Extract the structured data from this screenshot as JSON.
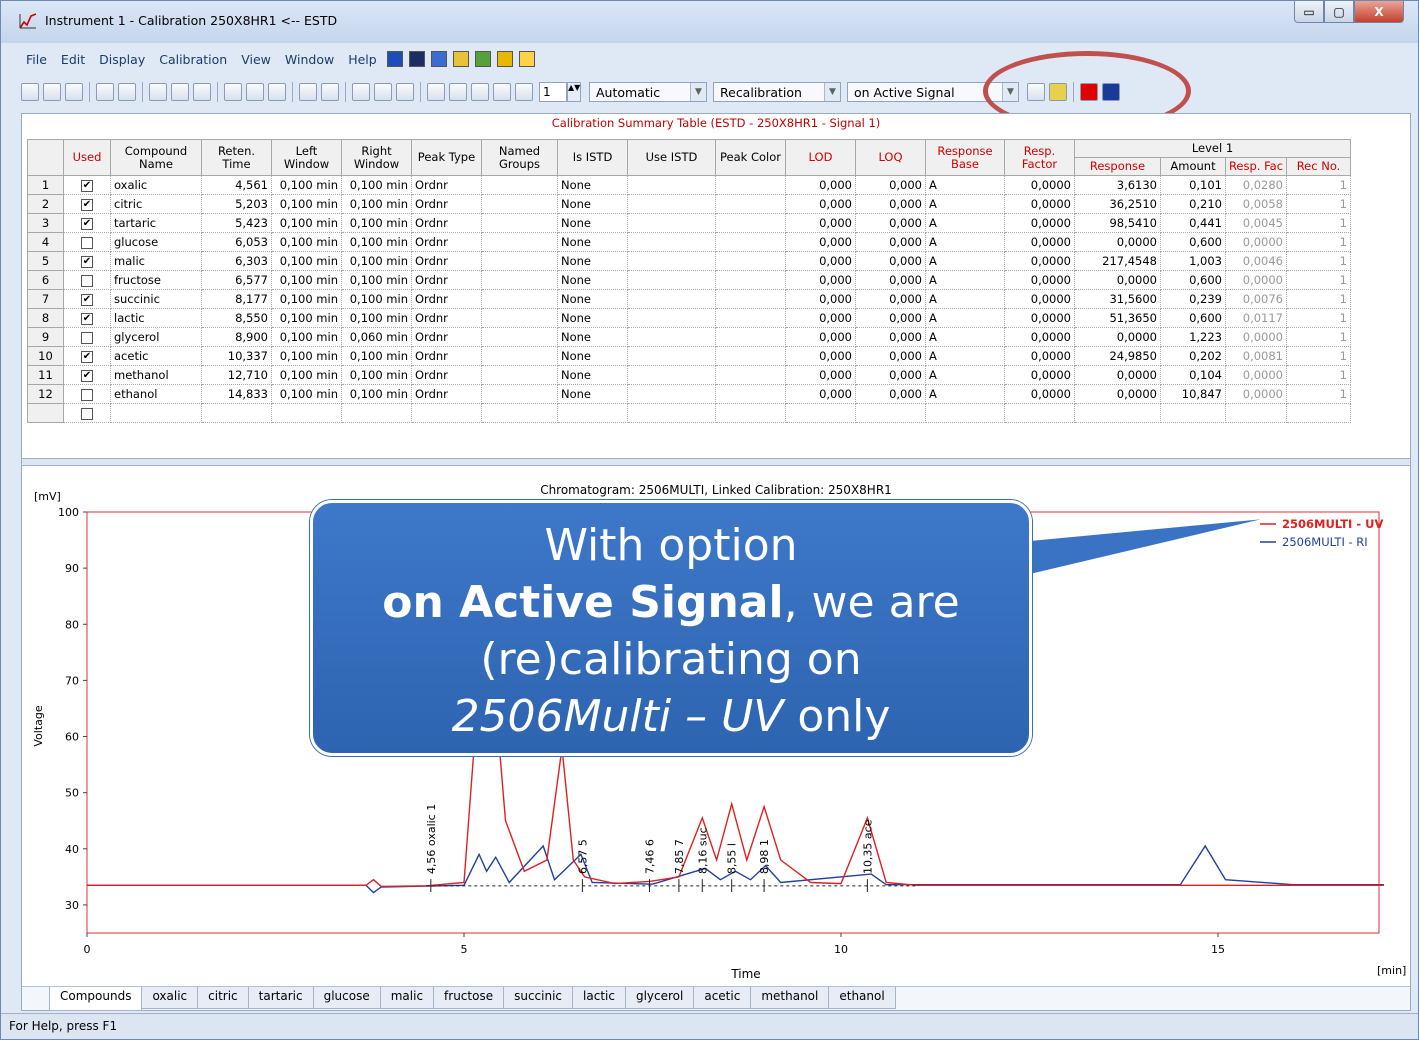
{
  "window": {
    "title": "Instrument 1 - Calibration 250X8HR1 <-- ESTD",
    "min": "▭",
    "max": "▢",
    "close": "X"
  },
  "menu": [
    "File",
    "Edit",
    "Display",
    "Calibration",
    "View",
    "Window",
    "Help"
  ],
  "toolbar": {
    "spin_value": "1",
    "mode": "Automatic",
    "cal_action": "Recalibration",
    "signal_option": "on Active Signal"
  },
  "table": {
    "title": "Calibration Summary Table (ESTD - 250X8HR1 - Signal 1)",
    "headers": {
      "used": "Used",
      "name": "Compound Name",
      "ret": "Reten. Time",
      "left": "Left Window",
      "right": "Right Window",
      "ptype": "Peak Type",
      "named": "Named Groups",
      "istd": "Is ISTD",
      "useistd": "Use ISTD",
      "color": "Peak Color",
      "lod": "LOD",
      "loq": "LOQ",
      "rbase": "Response Base",
      "rfactor": "Resp. Factor",
      "level": "Level 1",
      "response": "Response",
      "amount": "Amount",
      "respfac": "Resp. Fac",
      "recno": "Rec No."
    },
    "rows": [
      {
        "n": "1",
        "used": true,
        "name": "oxalic",
        "ret": "4,561",
        "left": "0,100 min",
        "right": "0,100 min",
        "ptype": "Ordnr",
        "istd": "None",
        "lod": "0,000",
        "loq": "0,000",
        "rbase": "A",
        "rfactor": "0,0000",
        "response": "3,6130",
        "amount": "0,101",
        "respfac": "0,0280",
        "recno": "1"
      },
      {
        "n": "2",
        "used": true,
        "name": "citric",
        "ret": "5,203",
        "left": "0,100 min",
        "right": "0,100 min",
        "ptype": "Ordnr",
        "istd": "None",
        "lod": "0,000",
        "loq": "0,000",
        "rbase": "A",
        "rfactor": "0,0000",
        "response": "36,2510",
        "amount": "0,210",
        "respfac": "0,0058",
        "recno": "1"
      },
      {
        "n": "3",
        "used": true,
        "name": "tartaric",
        "ret": "5,423",
        "left": "0,100 min",
        "right": "0,100 min",
        "ptype": "Ordnr",
        "istd": "None",
        "lod": "0,000",
        "loq": "0,000",
        "rbase": "A",
        "rfactor": "0,0000",
        "response": "98,5410",
        "amount": "0,441",
        "respfac": "0,0045",
        "recno": "1"
      },
      {
        "n": "4",
        "used": false,
        "name": "glucose",
        "ret": "6,053",
        "left": "0,100 min",
        "right": "0,100 min",
        "ptype": "Ordnr",
        "istd": "None",
        "lod": "0,000",
        "loq": "0,000",
        "rbase": "A",
        "rfactor": "0,0000",
        "response": "0,0000",
        "amount": "0,600",
        "respfac": "0,0000",
        "recno": "1"
      },
      {
        "n": "5",
        "used": true,
        "name": "malic",
        "ret": "6,303",
        "left": "0,100 min",
        "right": "0,100 min",
        "ptype": "Ordnr",
        "istd": "None",
        "lod": "0,000",
        "loq": "0,000",
        "rbase": "A",
        "rfactor": "0,0000",
        "response": "217,4548",
        "amount": "1,003",
        "respfac": "0,0046",
        "recno": "1"
      },
      {
        "n": "6",
        "used": false,
        "name": "fructose",
        "ret": "6,577",
        "left": "0,100 min",
        "right": "0,100 min",
        "ptype": "Ordnr",
        "istd": "None",
        "lod": "0,000",
        "loq": "0,000",
        "rbase": "A",
        "rfactor": "0,0000",
        "response": "0,0000",
        "amount": "0,600",
        "respfac": "0,0000",
        "recno": "1"
      },
      {
        "n": "7",
        "used": true,
        "name": "succinic",
        "ret": "8,177",
        "left": "0,100 min",
        "right": "0,100 min",
        "ptype": "Ordnr",
        "istd": "None",
        "lod": "0,000",
        "loq": "0,000",
        "rbase": "A",
        "rfactor": "0,0000",
        "response": "31,5600",
        "amount": "0,239",
        "respfac": "0,0076",
        "recno": "1"
      },
      {
        "n": "8",
        "used": true,
        "name": "lactic",
        "ret": "8,550",
        "left": "0,100 min",
        "right": "0,100 min",
        "ptype": "Ordnr",
        "istd": "None",
        "lod": "0,000",
        "loq": "0,000",
        "rbase": "A",
        "rfactor": "0,0000",
        "response": "51,3650",
        "amount": "0,600",
        "respfac": "0,0117",
        "recno": "1"
      },
      {
        "n": "9",
        "used": false,
        "name": "glycerol",
        "ret": "8,900",
        "left": "0,100 min",
        "right": "0,060 min",
        "ptype": "Ordnr",
        "istd": "None",
        "lod": "0,000",
        "loq": "0,000",
        "rbase": "A",
        "rfactor": "0,0000",
        "response": "0,0000",
        "amount": "1,223",
        "respfac": "0,0000",
        "recno": "1"
      },
      {
        "n": "10",
        "used": true,
        "name": "acetic",
        "ret": "10,337",
        "left": "0,100 min",
        "right": "0,100 min",
        "ptype": "Ordnr",
        "istd": "None",
        "lod": "0,000",
        "loq": "0,000",
        "rbase": "A",
        "rfactor": "0,0000",
        "response": "24,9850",
        "amount": "0,202",
        "respfac": "0,0081",
        "recno": "1"
      },
      {
        "n": "11",
        "used": true,
        "name": "methanol",
        "ret": "12,710",
        "left": "0,100 min",
        "right": "0,100 min",
        "ptype": "Ordnr",
        "istd": "None",
        "lod": "0,000",
        "loq": "0,000",
        "rbase": "A",
        "rfactor": "0,0000",
        "response": "0,0000",
        "amount": "0,104",
        "respfac": "0,0000",
        "recno": "1"
      },
      {
        "n": "12",
        "used": false,
        "name": "ethanol",
        "ret": "14,833",
        "left": "0,100 min",
        "right": "0,100 min",
        "ptype": "Ordnr",
        "istd": "None",
        "lod": "0,000",
        "loq": "0,000",
        "rbase": "A",
        "rfactor": "0,0000",
        "response": "0,0000",
        "amount": "10,847",
        "respfac": "0,0000",
        "recno": "1"
      }
    ]
  },
  "chart_data": {
    "type": "line",
    "title": "Chromatogram: 2506MULTI, Linked Calibration: 250X8HR1",
    "xlabel": "Time",
    "ylabel": "Voltage",
    "yunit": "[mV]",
    "xunit": "[min]",
    "xlim": [
      0,
      17.5
    ],
    "ylim": [
      25,
      100
    ],
    "xticks": [
      "0",
      "5",
      "10",
      "15"
    ],
    "yticks": [
      "30",
      "40",
      "50",
      "60",
      "70",
      "80",
      "90",
      "100"
    ],
    "series": [
      {
        "name": "2506MULTI - UV",
        "color": "#e02020",
        "points": [
          [
            0,
            33.5
          ],
          [
            3.7,
            33.5
          ],
          [
            3.8,
            34.5
          ],
          [
            3.9,
            33.3
          ],
          [
            4.5,
            33.4
          ],
          [
            5.0,
            34
          ],
          [
            5.2,
            70
          ],
          [
            5.3,
            60
          ],
          [
            5.42,
            66
          ],
          [
            5.55,
            45
          ],
          [
            5.8,
            36
          ],
          [
            6.1,
            38
          ],
          [
            6.3,
            58
          ],
          [
            6.45,
            38
          ],
          [
            6.6,
            35
          ],
          [
            7.0,
            33.8
          ],
          [
            7.46,
            34.2
          ],
          [
            7.85,
            35
          ],
          [
            8.16,
            45.5
          ],
          [
            8.35,
            38
          ],
          [
            8.55,
            48
          ],
          [
            8.75,
            38
          ],
          [
            8.98,
            47.5
          ],
          [
            9.2,
            38
          ],
          [
            9.6,
            34
          ],
          [
            10.0,
            33.8
          ],
          [
            10.35,
            45.5
          ],
          [
            10.6,
            34
          ],
          [
            11,
            33.5
          ],
          [
            17.2,
            33.5
          ]
        ]
      },
      {
        "name": "2506MULTI - RI",
        "color": "#2040a0",
        "points": [
          [
            0,
            33.5
          ],
          [
            3.7,
            33.5
          ],
          [
            3.8,
            32.2
          ],
          [
            3.9,
            33.2
          ],
          [
            5.0,
            33.5
          ],
          [
            5.2,
            39
          ],
          [
            5.3,
            36
          ],
          [
            5.42,
            38.5
          ],
          [
            5.6,
            34
          ],
          [
            6.05,
            40.5
          ],
          [
            6.2,
            34.5
          ],
          [
            6.55,
            39
          ],
          [
            6.7,
            34
          ],
          [
            7.5,
            33.7
          ],
          [
            8.2,
            36.5
          ],
          [
            8.4,
            34.5
          ],
          [
            8.6,
            36
          ],
          [
            8.8,
            34.5
          ],
          [
            9.0,
            37
          ],
          [
            9.2,
            34
          ],
          [
            10.4,
            35.5
          ],
          [
            10.6,
            33.6
          ],
          [
            14.5,
            33.6
          ],
          [
            14.83,
            40.5
          ],
          [
            15.1,
            34.5
          ],
          [
            16,
            33.6
          ],
          [
            17.2,
            33.6
          ]
        ]
      }
    ],
    "peak_labels": [
      {
        "t": 4.56,
        "text": "4,56 oxalic  1"
      },
      {
        "t": 6.57,
        "text": "6,57  5"
      },
      {
        "t": 7.46,
        "text": "7,46  6"
      },
      {
        "t": 7.85,
        "text": "7,85  7"
      },
      {
        "t": 8.16,
        "text": "8,16 suc"
      },
      {
        "t": 8.55,
        "text": "8,55 l"
      },
      {
        "t": 8.98,
        "text": "8,98  1"
      },
      {
        "t": 10.35,
        "text": "10,35 ace"
      }
    ]
  },
  "tabs": [
    "Compounds",
    "oxalic",
    "citric",
    "tartaric",
    "glucose",
    "malic",
    "fructose",
    "succinic",
    "lactic",
    "glycerol",
    "acetic",
    "methanol",
    "ethanol"
  ],
  "status": "For Help, press F1",
  "callout": {
    "l1": "With option",
    "l2a": "on Active Signal",
    "l2b": ", we are",
    "l3": "(re)calibrating on",
    "l4a": "2506Multi – UV",
    "l4b": " only"
  }
}
